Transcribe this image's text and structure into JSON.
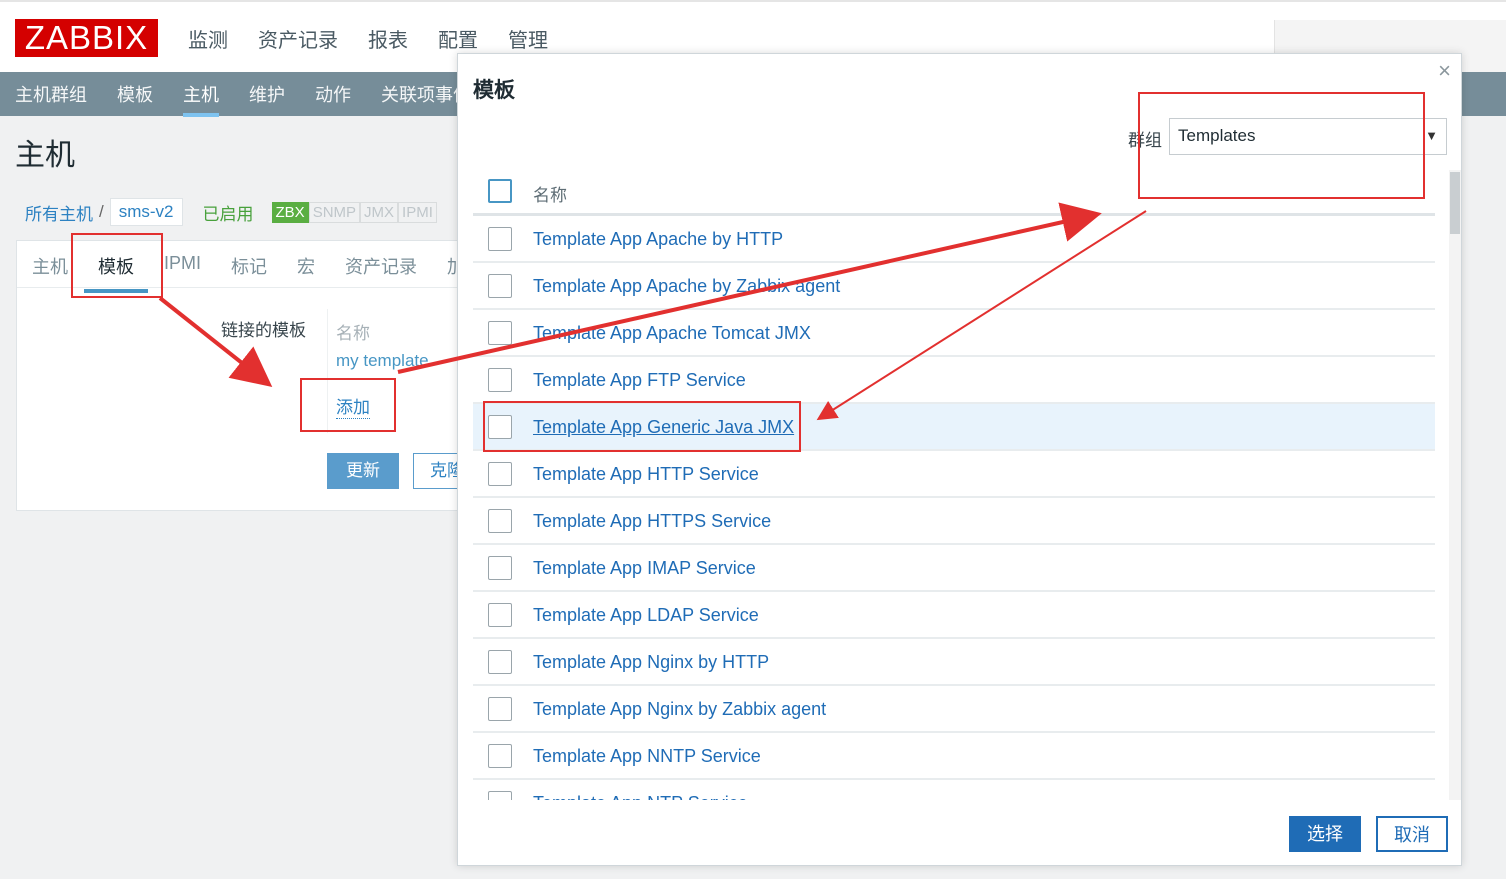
{
  "header": {
    "logo": "ZABBIX",
    "nav": [
      "监测",
      "资产记录",
      "报表",
      "配置",
      "管理"
    ]
  },
  "subnav": {
    "items": [
      "主机群组",
      "模板",
      "主机",
      "维护",
      "动作",
      "关联项事件"
    ],
    "active": "主机"
  },
  "page": {
    "title": "主机",
    "breadcrumb_all": "所有主机",
    "breadcrumb_sep": "/",
    "host_name": "sms-v2",
    "status": "已启用",
    "tags": [
      "ZBX",
      "SNMP",
      "JMX",
      "IPMI"
    ]
  },
  "form": {
    "tabs": [
      "主机",
      "模板",
      "IPMI",
      "标记",
      "宏",
      "资产记录",
      "加"
    ],
    "active_tab": "模板",
    "linked_label": "链接的模板",
    "col_name": "名称",
    "linked_item": "my template",
    "add_link": "添加",
    "update_button": "更新",
    "clone_button": "克隆"
  },
  "dialog": {
    "title": "模板",
    "close": "×",
    "group_label": "群组",
    "group_value": "Templates",
    "col_name": "名称",
    "rows": [
      "Template App Apache by HTTP",
      "Template App Apache by Zabbix agent",
      "Template App Apache Tomcat JMX",
      "Template App FTP Service",
      "Template App Generic Java JMX",
      "Template App HTTP Service",
      "Template App HTTPS Service",
      "Template App IMAP Service",
      "Template App LDAP Service",
      "Template App Nginx by HTTP",
      "Template App Nginx by Zabbix agent",
      "Template App NNTP Service",
      "Template App NTP Service"
    ],
    "highlighted_row": 4,
    "select_button": "选择",
    "cancel_button": "取消"
  },
  "colors": {
    "brand": "#d40000",
    "subnav": "#768d99",
    "link": "#1f6cb6",
    "annotation": "#e2302f"
  }
}
